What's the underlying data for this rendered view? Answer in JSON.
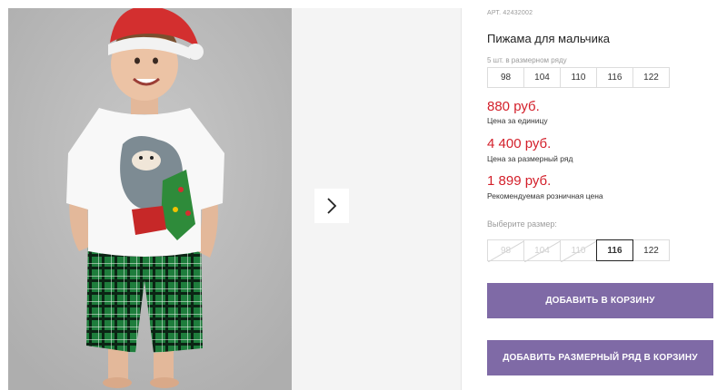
{
  "gallery": {
    "next_icon": "chevron-right-icon"
  },
  "product": {
    "article_label": "АРТ. 42432002",
    "title": "Пижама для мальчика",
    "size_row_label": "5 шт. в размерном ряду",
    "size_row": [
      "98",
      "104",
      "110",
      "116",
      "122"
    ]
  },
  "prices": [
    {
      "value": "880 руб.",
      "note": "Цена за единицу"
    },
    {
      "value": "4 400 руб.",
      "note": "Цена за размерный ряд"
    },
    {
      "value": "1 899 руб.",
      "note": "Рекомендуемая розничная цена"
    }
  ],
  "size_select": {
    "label": "Выберите размер:",
    "options": [
      {
        "label": "98",
        "state": "disabled"
      },
      {
        "label": "104",
        "state": "disabled"
      },
      {
        "label": "110",
        "state": "disabled"
      },
      {
        "label": "116",
        "state": "selected"
      },
      {
        "label": "122",
        "state": "available"
      }
    ]
  },
  "actions": {
    "add_to_cart": "ДОБАВИТЬ В КОРЗИНУ",
    "add_row_to_cart": "ДОБАВИТЬ РАЗМЕРНЫЙ РЯД В КОРЗИНУ"
  },
  "colors": {
    "price": "#d31f2a",
    "button": "#7f6aa6",
    "photo_background": "#bcbcbc",
    "shorts": "#1f7a3c",
    "hat": "#d32f2f"
  }
}
